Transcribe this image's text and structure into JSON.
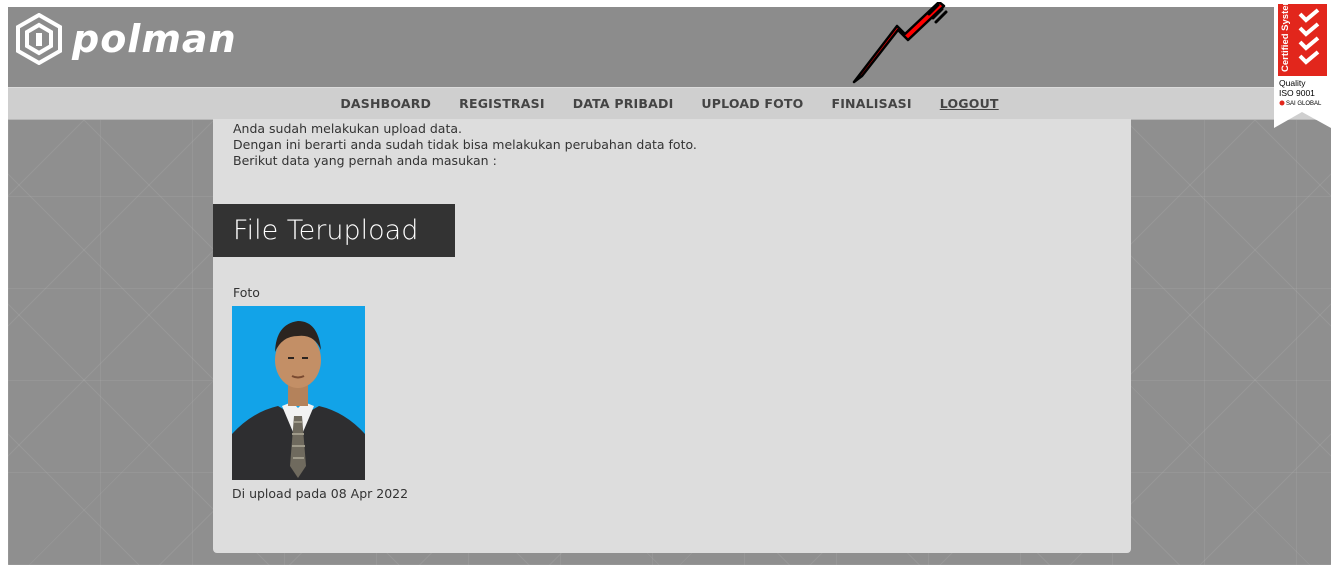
{
  "brand": {
    "logo_text": "polman"
  },
  "nav": {
    "items": [
      {
        "label": "DASHBOARD"
      },
      {
        "label": "REGISTRASI"
      },
      {
        "label": "DATA PRIBADI"
      },
      {
        "label": "UPLOAD FOTO"
      },
      {
        "label": "FINALISASI"
      },
      {
        "label": "LOGOUT"
      }
    ]
  },
  "content": {
    "messages": [
      "Anda sudah melakukan upload data.",
      "Dengan ini berarti anda sudah tidak bisa melakukan perubahan data foto.",
      "Berikut data yang pernah anda masukan :"
    ],
    "section_title": "File Terupload",
    "foto_label": "Foto",
    "upload_date": "Di upload pada 08 Apr 2022"
  },
  "badge": {
    "line1": "Certified System",
    "line2": "Quality",
    "line3": "ISO 9001",
    "line4": "SAI GLOBAL"
  },
  "colors": {
    "header_bg": "#8c8c8c",
    "nav_bg": "#cfcfcf",
    "panel_bg": "#dddddd",
    "title_bg": "#333333",
    "photo_bg": "#12a3e8",
    "arrow": "#ff0000",
    "badge_red": "#e2261c"
  }
}
